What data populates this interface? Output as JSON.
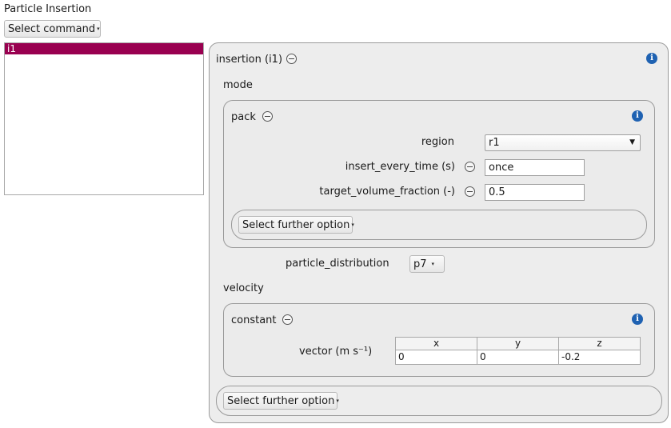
{
  "window": {
    "title": "Particle Insertion"
  },
  "toolbar": {
    "select_command_label": "Select command"
  },
  "list": {
    "items": [
      "i1"
    ]
  },
  "insertion": {
    "title": "insertion (i1)",
    "mode_label": "mode",
    "pack": {
      "title": "pack",
      "fields": {
        "region": {
          "label": "region",
          "value": "r1"
        },
        "insert_every_time": {
          "label": "insert_every_time (s)",
          "value": "once"
        },
        "target_volume_fraction": {
          "label": "target_volume_fraction (-)",
          "value": "0.5"
        }
      },
      "further_option_label": "Select further option"
    },
    "particle_distribution": {
      "label": "particle_distribution",
      "value": "p7"
    },
    "velocity_label": "velocity",
    "constant": {
      "title": "constant",
      "vector_label": "vector (m s⁻¹)",
      "columns": [
        "x",
        "y",
        "z"
      ],
      "values": [
        "0",
        "0",
        "-0.2"
      ]
    },
    "further_option_label": "Select further option"
  },
  "icons": {
    "info": "info-icon",
    "collapse": "minus-circle-icon",
    "dropdown": "chevron-down-icon"
  },
  "colors": {
    "selection": "#990050",
    "info": "#1f62b2",
    "panel_bg": "#ededed"
  }
}
